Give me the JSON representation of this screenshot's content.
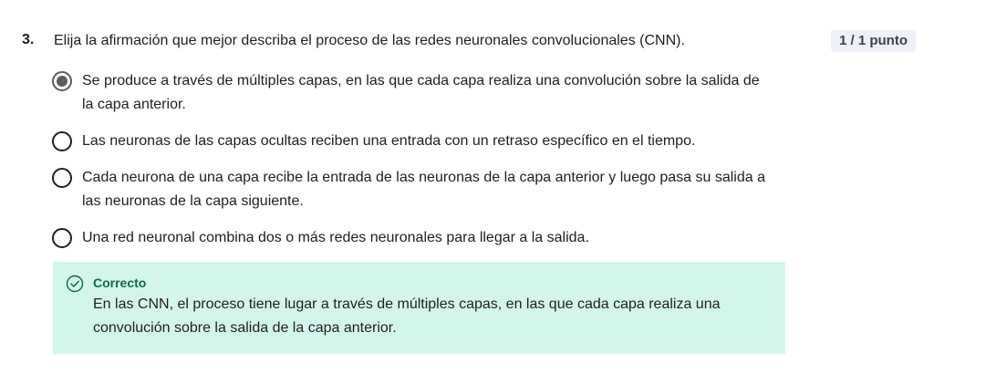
{
  "question": {
    "number": "3.",
    "text": "Elija la afirmación que mejor describa el proceso de las redes neuronales convolucionales (CNN).",
    "score": "1 / 1 punto"
  },
  "options": [
    {
      "line1": "Se produce a través de múltiples capas, en las que cada capa realiza una convolución sobre la salida de",
      "line2": "la capa anterior.",
      "selected": true
    },
    {
      "line1": "Las neuronas de las capas ocultas reciben una entrada con un retraso específico en el tiempo.",
      "line2": "",
      "selected": false
    },
    {
      "line1": "Cada neurona de una capa recibe la entrada de las neuronas de la capa anterior y luego pasa su salida a",
      "line2": "las neuronas de la capa siguiente.",
      "selected": false
    },
    {
      "line1": "Una red neuronal combina dos o más redes neuronales para llegar a la salida.",
      "line2": "",
      "selected": false
    }
  ],
  "feedback": {
    "icon": "check-circle-icon",
    "title": "Correcto",
    "line1": "En las CNN, el proceso tiene lugar a través de múltiples capas, en las que cada capa realiza una",
    "line2": "convolución sobre la salida de la capa anterior."
  },
  "colors": {
    "feedback_bg": "#d3f6eb",
    "feedback_title": "#0a6b4a",
    "score_bg": "#eef1f7"
  }
}
